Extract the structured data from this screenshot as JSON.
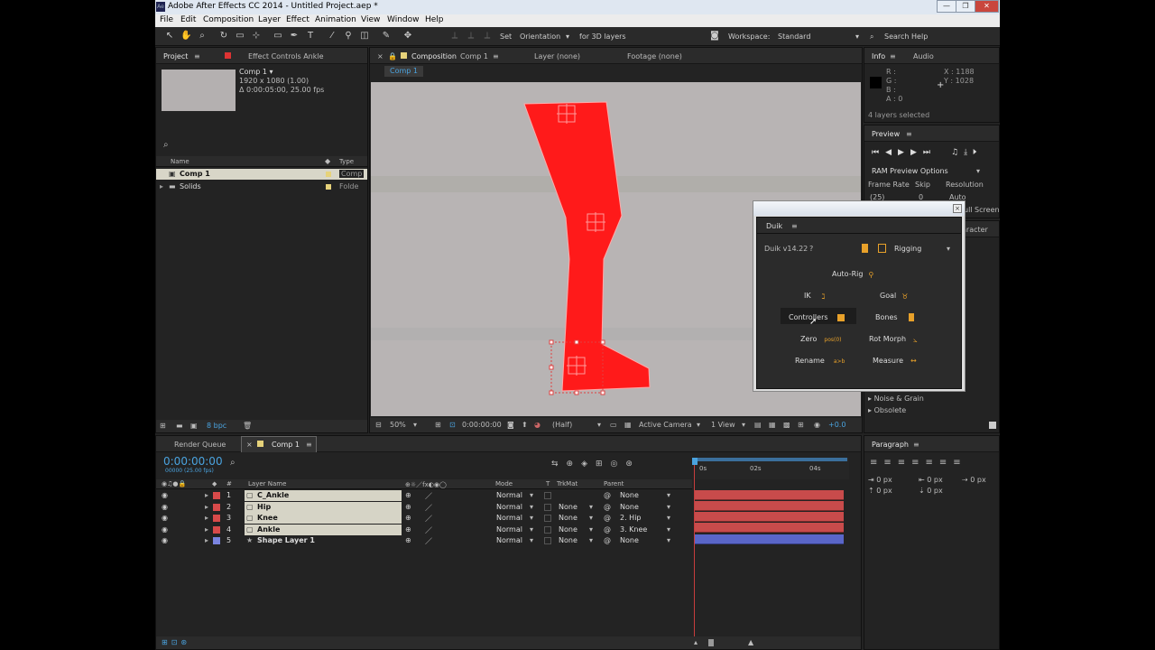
{
  "window": {
    "title": "Adobe After Effects CC 2014 - Untitled Project.aep *",
    "app_badge": "Ae",
    "min": "—",
    "max": "❐",
    "close": "✕"
  },
  "menu": [
    "File",
    "Edit",
    "Composition",
    "Layer",
    "Effect",
    "Animation",
    "View",
    "Window",
    "Help"
  ],
  "toolbar": {
    "set_label": "Set",
    "orientation": "Orientation",
    "for3d": "for 3D layers",
    "workspace_label": "Workspace:",
    "workspace_value": "Standard",
    "search": "Search Help"
  },
  "project": {
    "tabs": [
      "Project",
      "Effect Controls Ankle"
    ],
    "comp_name": "Comp 1 ▾",
    "comp_size": "1920 x 1080 (1.00)",
    "comp_duration": "Δ 0:00:05:00, 25.00 fps",
    "search_icon": "⌕",
    "col_name": "Name",
    "col_type": "Type",
    "items": [
      {
        "name": "Comp 1",
        "type": "Comp"
      },
      {
        "name": "Solids",
        "type": "Folde"
      }
    ],
    "bpc": "8 bpc"
  },
  "composition": {
    "tabs": [
      "Composition",
      "Comp 1",
      "Layer (none)",
      "Footage (none)"
    ],
    "crumb": "Comp 1",
    "zoom": "50%",
    "time": "0:00:00:00",
    "resolution": "(Half)",
    "camera": "Active Camera",
    "view": "1 View",
    "exposure": "+0.0"
  },
  "info": {
    "tabs": [
      "Info",
      "Audio"
    ],
    "r": "R :",
    "g": "G :",
    "b": "B :",
    "a": "A : 0",
    "x": "X : 1188",
    "y": "Y : 1028",
    "selected": "4 layers selected"
  },
  "preview": {
    "title": "Preview",
    "ram": "RAM Preview Options",
    "frame_rate_label": "Frame Rate",
    "skip_label": "Skip",
    "resolution_label": "Resolution",
    "frame_rate": "(25)",
    "skip": "0",
    "resolution": "Auto",
    "full_screen": "ull Screen"
  },
  "effects": {
    "partial": "aracter",
    "items": [
      "Noise & Grain",
      "Obsolete"
    ]
  },
  "duik": {
    "tab": "Duik",
    "version": "Duik v14.22",
    "help": "?",
    "mode": "Rigging",
    "buttons": {
      "autorig": "Auto-Rig",
      "ik": "IK",
      "goal": "Goal",
      "controllers": "Controllers",
      "bones": "Bones",
      "zero": "Zero",
      "zero_tag": "pos(0)",
      "rotmorph": "Rot Morph",
      "rename": "Rename",
      "rename_tag": "a>b",
      "measure": "Measure"
    }
  },
  "timeline": {
    "tabs": [
      "Render Queue",
      "Comp 1"
    ],
    "timecode": "0:00:00:00",
    "timecode_sub": "00000 (25.00 fps)",
    "col_layer_name": "Layer Name",
    "col_mode": "Mode",
    "col_t": "T",
    "col_trkmat": "TrkMat",
    "col_parent": "Parent",
    "ruler": [
      "0s",
      "02s",
      "04s"
    ],
    "layers": [
      {
        "num": "1",
        "name": "C_Ankle",
        "mode": "Normal",
        "trkmat": "",
        "parent": "None",
        "color": "#d84a4a"
      },
      {
        "num": "2",
        "name": "Hip",
        "mode": "Normal",
        "trkmat": "None",
        "parent": "None",
        "color": "#d84a4a"
      },
      {
        "num": "3",
        "name": "Knee",
        "mode": "Normal",
        "trkmat": "None",
        "parent": "2. Hip",
        "color": "#d84a4a"
      },
      {
        "num": "4",
        "name": "Ankle",
        "mode": "Normal",
        "trkmat": "None",
        "parent": "3. Knee",
        "color": "#d84a4a"
      },
      {
        "num": "5",
        "name": "Shape Layer 1",
        "mode": "Normal",
        "trkmat": "None",
        "parent": "None",
        "color": "#7a84e0"
      }
    ]
  },
  "paragraph": {
    "title": "Paragraph",
    "px1": "0 px",
    "px2": "0 px",
    "px3": "0 px",
    "px4": "0 px",
    "px5": "0 px"
  }
}
